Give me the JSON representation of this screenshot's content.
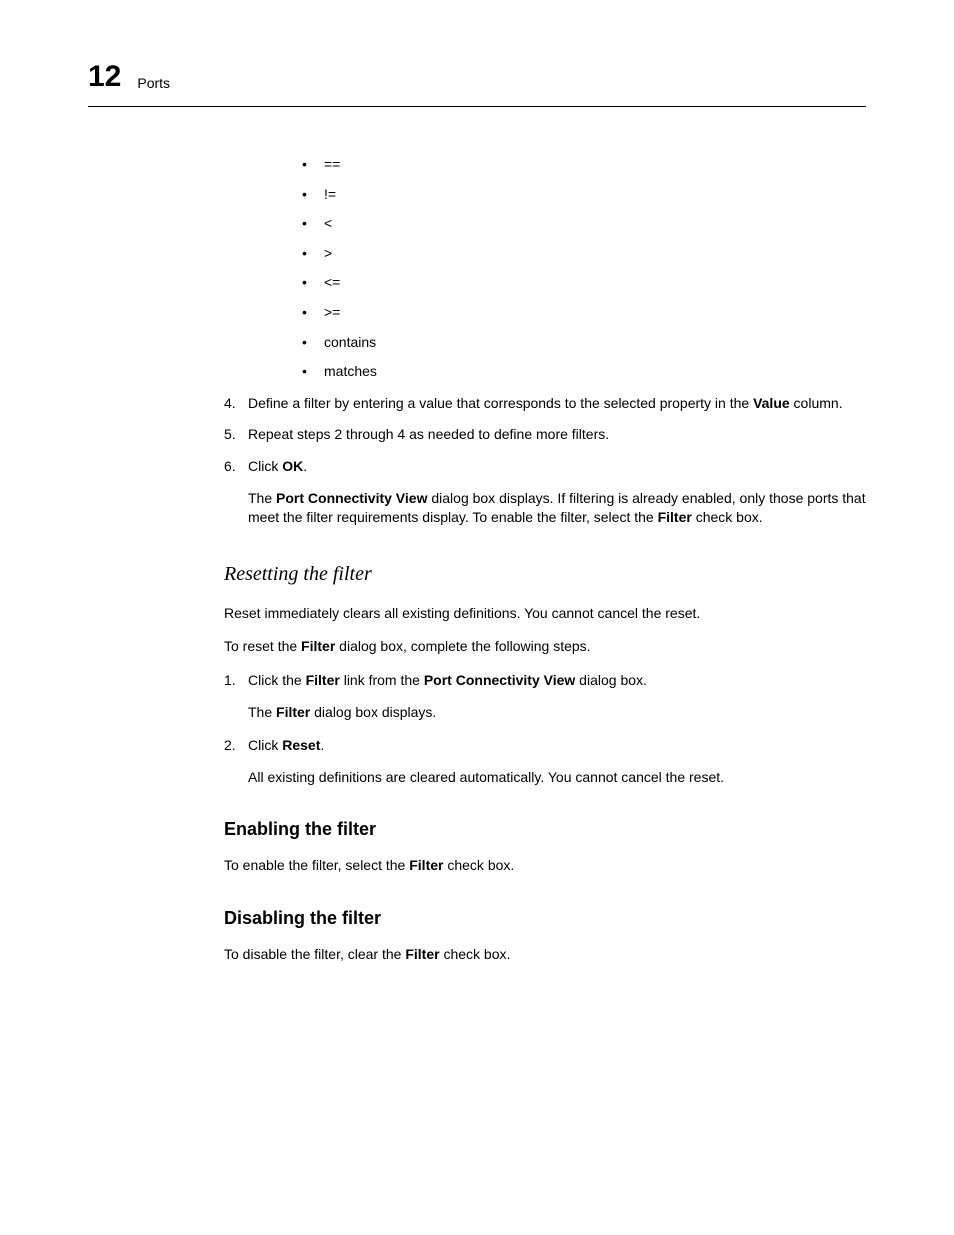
{
  "header": {
    "chapter_number": "12",
    "chapter_title": "Ports"
  },
  "operators": [
    "==",
    "!=",
    "<",
    ">",
    "<=",
    ">=",
    "contains",
    "matches"
  ],
  "step4": {
    "num": "4.",
    "text_before": "Define a filter by entering a value that corresponds to the selected property in the ",
    "bold1": "Value",
    "text_after": " column."
  },
  "step5": {
    "num": "5.",
    "text": "Repeat steps 2 through 4 as needed to define more filters."
  },
  "step6": {
    "num": "6.",
    "text_before": "Click ",
    "bold1": "OK",
    "text_after": "."
  },
  "step6_result": {
    "text_before": "The ",
    "bold1": "Port Connectivity View",
    "text_mid": " dialog box displays. If filtering is already enabled, only those ports that meet the filter requirements display. To enable the filter, select the ",
    "bold2": "Filter",
    "text_after": " check box."
  },
  "resetting": {
    "heading": "Resetting the filter",
    "para1": "Reset immediately clears all existing definitions. You cannot cancel the reset.",
    "para2_before": "To reset the ",
    "para2_bold": "Filter",
    "para2_after": " dialog box, complete the following steps.",
    "step1": {
      "num": "1.",
      "text_before": "Click the ",
      "bold1": "Filter",
      "text_mid": " link from the ",
      "bold2": "Port Connectivity View",
      "text_after": " dialog box."
    },
    "step1_result": {
      "text_before": "The ",
      "bold1": "Filter",
      "text_after": " dialog box displays."
    },
    "step2": {
      "num": "2.",
      "text_before": "Click ",
      "bold1": "Reset",
      "text_after": "."
    },
    "step2_result": "All existing definitions are cleared automatically. You cannot cancel the reset."
  },
  "enabling": {
    "heading": "Enabling the filter",
    "text_before": "To enable the filter, select the ",
    "bold1": "Filter",
    "text_after": " check box."
  },
  "disabling": {
    "heading": "Disabling the filter",
    "text_before": "To disable the filter, clear the ",
    "bold1": "Filter",
    "text_after": " check box."
  }
}
